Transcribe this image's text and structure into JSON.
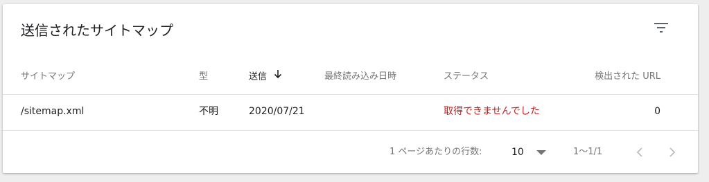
{
  "card": {
    "title": "送信されたサイトマップ",
    "filter_icon": "filter-list-icon"
  },
  "table": {
    "columns": [
      {
        "key": "sitemap",
        "label": "サイトマップ"
      },
      {
        "key": "type",
        "label": "型"
      },
      {
        "key": "submitted",
        "label": "送信",
        "sorted": "descending",
        "icon": "arrow-down-icon"
      },
      {
        "key": "last_read",
        "label": "最終読み込み日時"
      },
      {
        "key": "status",
        "label": "ステータス"
      },
      {
        "key": "discovered_urls",
        "label": "検出された URL"
      }
    ],
    "rows": [
      {
        "sitemap": "/sitemap.xml",
        "type": "不明",
        "submitted": "2020/07/21",
        "last_read": "",
        "status": "取得できませんでした",
        "discovered_urls": "0"
      }
    ]
  },
  "pagination": {
    "rows_per_page_label": "1 ページあたりの行数:",
    "rows_per_page_value": "10",
    "range_label": "1〜1/1",
    "prev_icon": "chevron-left-icon",
    "next_icon": "chevron-right-icon"
  },
  "colors": {
    "error": "#c5221f",
    "text": "#202124",
    "muted": "#757575",
    "disabled": "#bdbdbd"
  }
}
